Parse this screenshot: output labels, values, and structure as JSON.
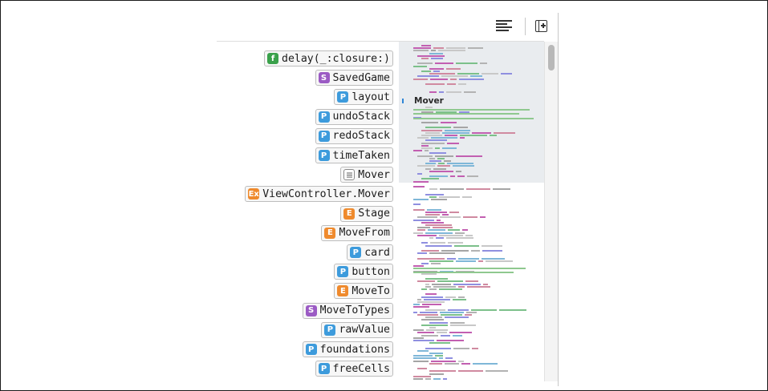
{
  "toolbar": {
    "icons": [
      "list-lines-icon",
      "add-editor-icon"
    ]
  },
  "symbols": [
    {
      "kind": "f",
      "badge": "f",
      "name": "delay(_:closure:)"
    },
    {
      "kind": "s",
      "badge": "S",
      "name": "SavedGame"
    },
    {
      "kind": "p",
      "badge": "P",
      "name": "layout"
    },
    {
      "kind": "p",
      "badge": "P",
      "name": "undoStack"
    },
    {
      "kind": "p",
      "badge": "P",
      "name": "redoStack"
    },
    {
      "kind": "p",
      "badge": "P",
      "name": "timeTaken"
    },
    {
      "kind": "m",
      "badge": "",
      "name": "Mover"
    },
    {
      "kind": "e",
      "badge": "Ex",
      "name": "ViewController.Mover"
    },
    {
      "kind": "e",
      "badge": "E",
      "name": "Stage"
    },
    {
      "kind": "e",
      "badge": "E",
      "name": "MoveFrom"
    },
    {
      "kind": "p",
      "badge": "P",
      "name": "card"
    },
    {
      "kind": "p",
      "badge": "P",
      "name": "button"
    },
    {
      "kind": "e",
      "badge": "E",
      "name": "MoveTo"
    },
    {
      "kind": "s",
      "badge": "S",
      "name": "MoveToTypes"
    },
    {
      "kind": "p",
      "badge": "P",
      "name": "rawValue"
    },
    {
      "kind": "p",
      "badge": "P",
      "name": "foundations"
    },
    {
      "kind": "p",
      "badge": "P",
      "name": "freeCells"
    }
  ],
  "minimap": {
    "section_label": "Mover"
  },
  "colors": {
    "function": "#3aa14b",
    "struct": "#9b5bc4",
    "property": "#3d9bdc",
    "enum": "#ef8a2d",
    "highlight": "#e9ecef"
  }
}
